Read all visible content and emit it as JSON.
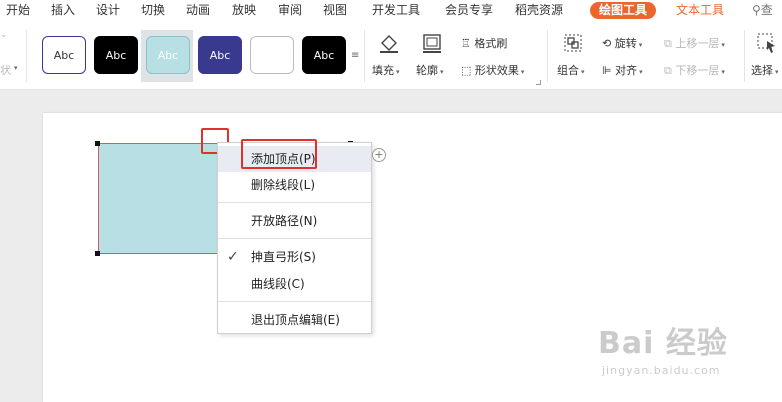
{
  "menu_tabs": [
    "开始",
    "插入",
    "设计",
    "切换",
    "动画",
    "放映",
    "审阅",
    "视图",
    "开发工具",
    "会员专享",
    "稻壳资源"
  ],
  "context_tabs": {
    "drawing_tools": "绘图工具",
    "text_tools": "文本工具"
  },
  "search_label": "查",
  "ribbon": {
    "left_fragment": "状",
    "style_swatches": [
      {
        "label": "Abc",
        "bg": "#ffffff",
        "fg": "#333333",
        "border": "#3a3a8f"
      },
      {
        "label": "Abc",
        "bg": "#000000",
        "fg": "#ffffff",
        "border": "#000000"
      },
      {
        "label": "Abc",
        "bg": "#b8dfe3",
        "fg": "#ffffff",
        "border": "#8cc4ca"
      },
      {
        "label": "Abc",
        "bg": "#39398f",
        "fg": "#ffffff",
        "border": "#39398f"
      },
      {
        "label": "",
        "bg": "#ffffff",
        "fg": "#333333",
        "border": "#bbbbbb"
      },
      {
        "label": "Abc",
        "bg": "#000000",
        "fg": "#ffffff",
        "border": "#000000"
      }
    ],
    "fill": "填充",
    "outline": "轮廓",
    "format_painter": "格式刷",
    "shape_effects": "形状效果",
    "group": "组合",
    "rotate": "旋转",
    "align": "对齐",
    "bring_forward": "上移一层",
    "send_backward": "下移一层",
    "select": "选择"
  },
  "context_menu": {
    "items": [
      {
        "label": "添加顶点(P)"
      },
      {
        "label": "删除线段(L)"
      },
      {
        "label": "开放路径(N)"
      },
      {
        "label": "抻直弓形(S)"
      },
      {
        "label": "曲线段(C)"
      },
      {
        "label": "退出顶点编辑(E)"
      }
    ]
  },
  "watermark": {
    "main": "Bai 经验",
    "sub": "jingyan.baidu.com"
  },
  "colors": {
    "accent": "#e9672f",
    "highlight_box": "#e0322d",
    "shape_fill": "#b8dfe3",
    "shape_outline": "#d25b5b"
  }
}
